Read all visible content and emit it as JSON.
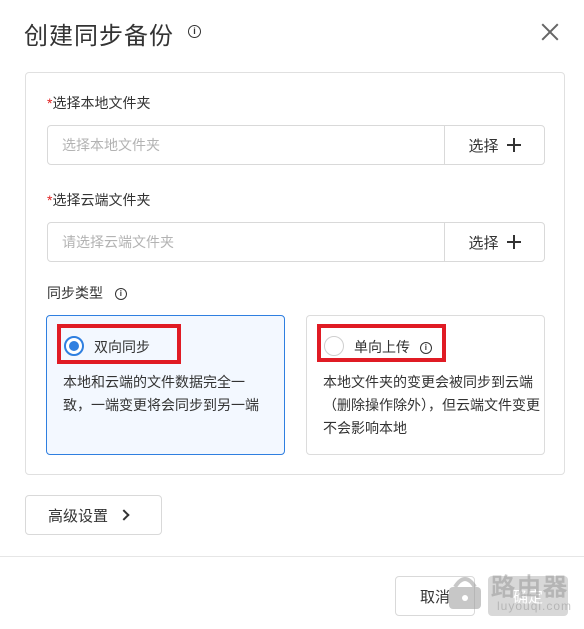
{
  "dialog": {
    "title": "创建同步备份",
    "local_folder": {
      "label": "选择本地文件夹",
      "required_mark": "*",
      "placeholder": "选择本地文件夹",
      "button_label": "选择"
    },
    "cloud_folder": {
      "label": "选择云端文件夹",
      "required_mark": "*",
      "placeholder": "请选择云端文件夹",
      "button_label": "选择"
    },
    "sync_type": {
      "label": "同步类型",
      "options": [
        {
          "title": "双向同步",
          "selected": true,
          "description": "本地和云端的文件数据完全一致，一端变更将会同步到另一端"
        },
        {
          "title": "单向上传",
          "selected": false,
          "description": "本地文件夹的变更会被同步到云端（删除操作除外），但云端文件变更不会影响本地"
        }
      ]
    },
    "advanced_button": "高级设置",
    "cancel_button": "取消",
    "ok_button": "确定"
  },
  "colors": {
    "accent": "#2f7fe0",
    "selected_card_bg": "#f3f8ff",
    "required": "#e02020",
    "annotation_box": "#e01b24",
    "ok_disabled": "#d8d8d8"
  },
  "watermark": {
    "text": "路由器",
    "subtext": "luyouqi.com"
  }
}
